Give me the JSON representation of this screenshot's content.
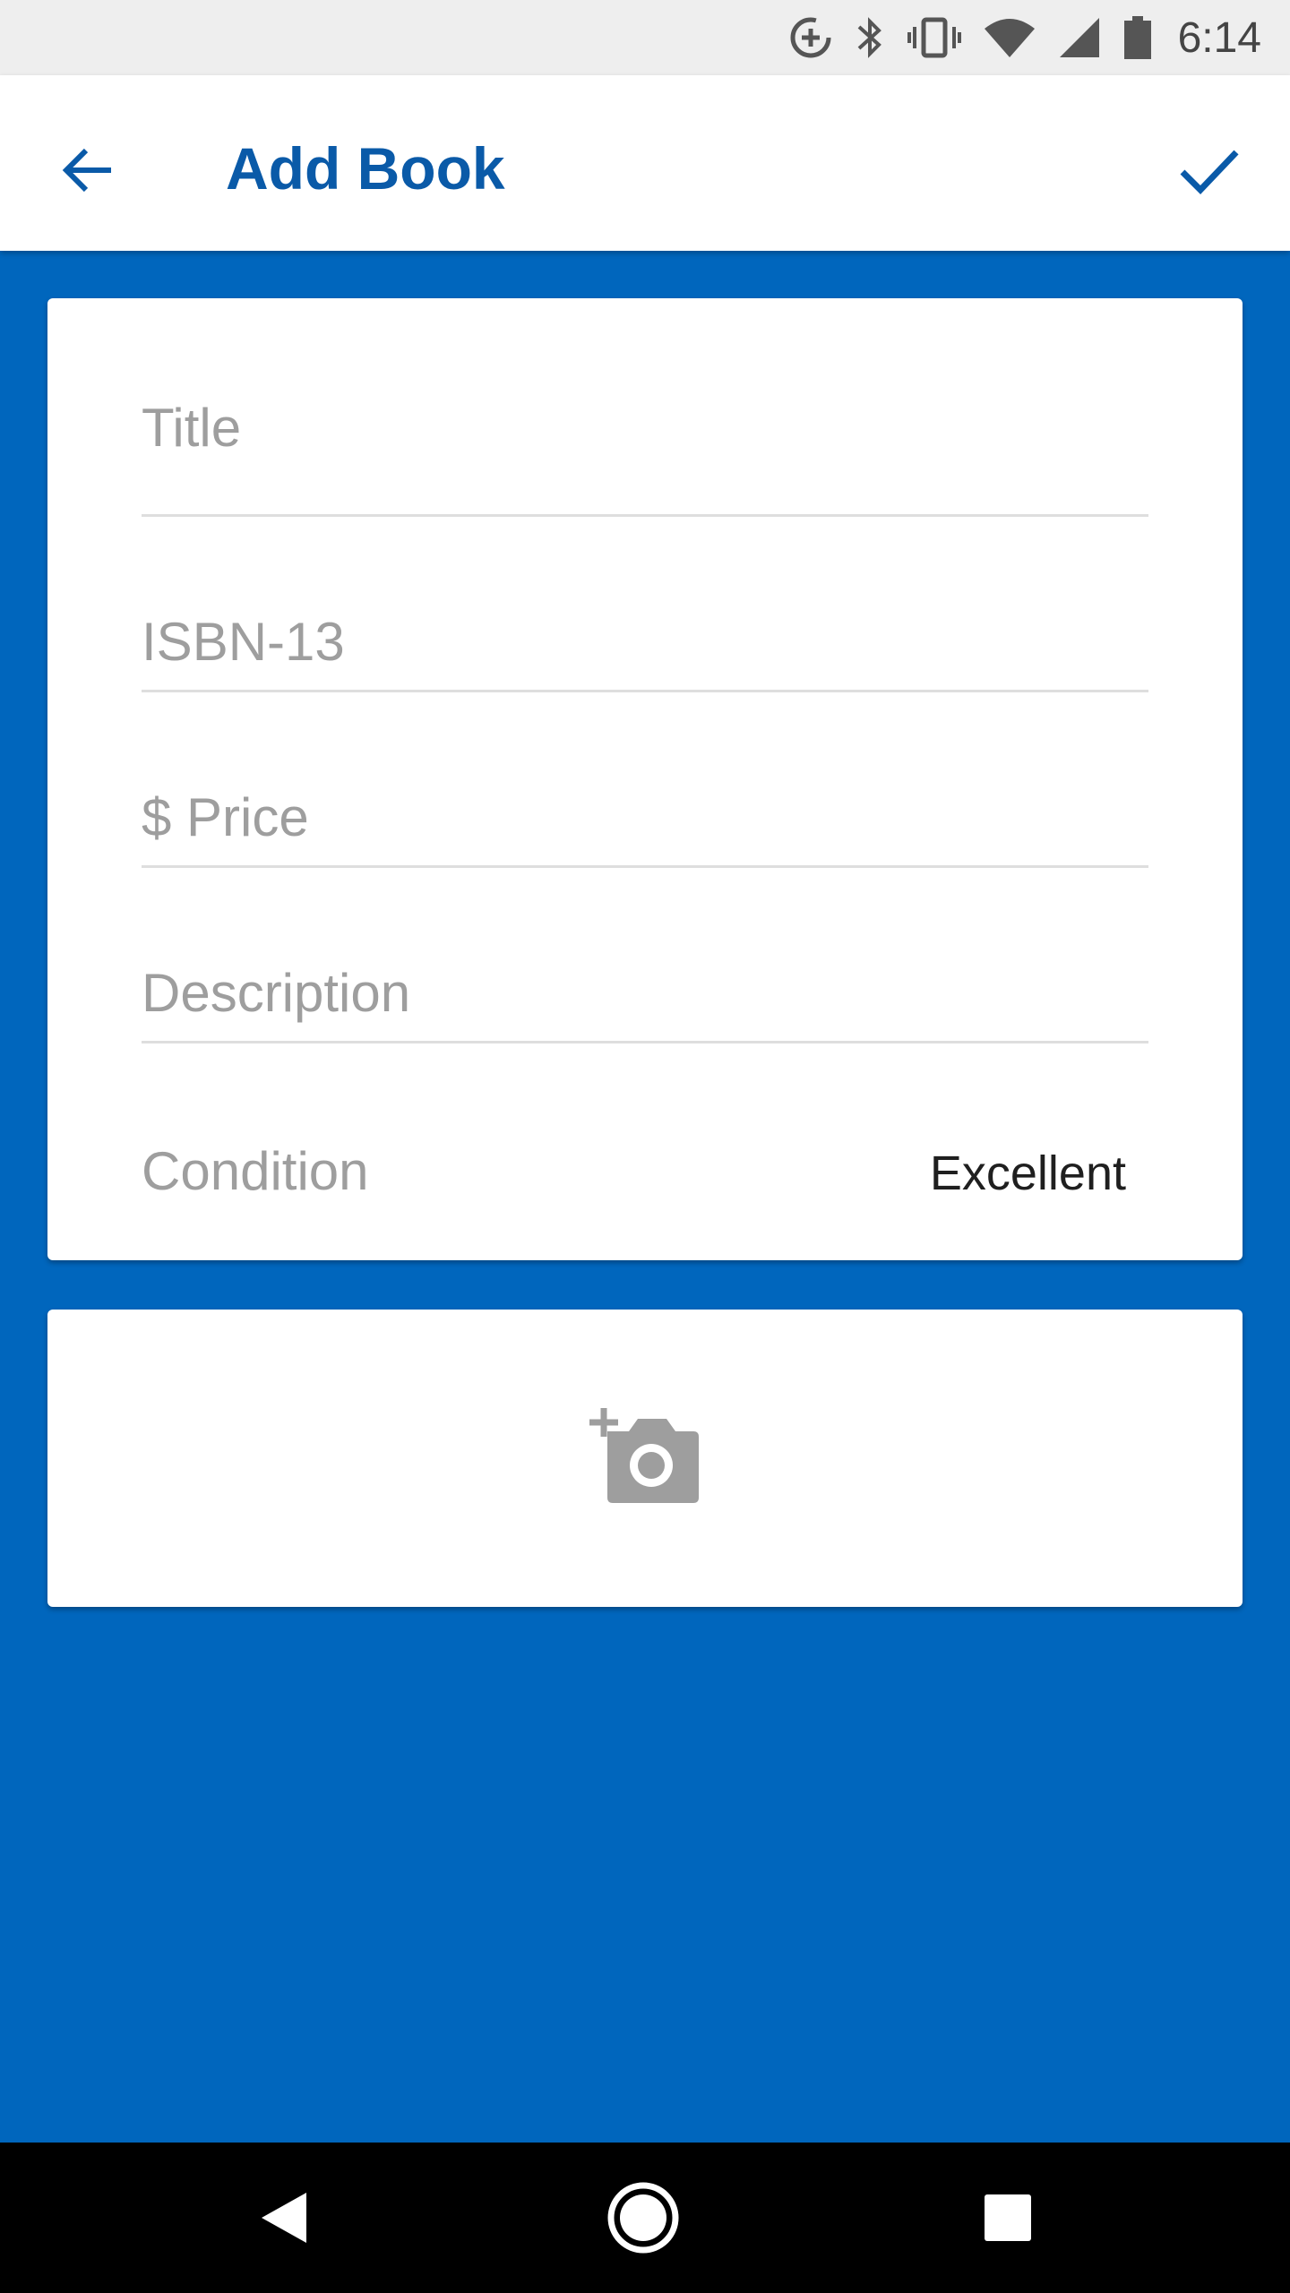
{
  "status_bar": {
    "time": "6:14",
    "icons": [
      "data-saver-icon",
      "bluetooth-icon",
      "vibrate-icon",
      "wifi-icon",
      "cell-signal-icon",
      "battery-icon"
    ]
  },
  "app_bar": {
    "title": "Add Book",
    "back_icon": "arrow-back-icon",
    "confirm_icon": "check-icon",
    "accent_color": "#0a5aa8"
  },
  "form": {
    "title_placeholder": "Title",
    "isbn_placeholder": "ISBN-13",
    "price_placeholder": "$ Price",
    "description_placeholder": "Description",
    "condition_label": "Condition",
    "condition_value": "Excellent"
  },
  "photo": {
    "icon": "add-photo-icon"
  },
  "nav_bar": {
    "icons": [
      "nav-back-icon",
      "nav-home-icon",
      "nav-recents-icon"
    ]
  },
  "colors": {
    "background": "#0066bd",
    "card": "#ffffff",
    "placeholder": "#9e9e9e"
  }
}
